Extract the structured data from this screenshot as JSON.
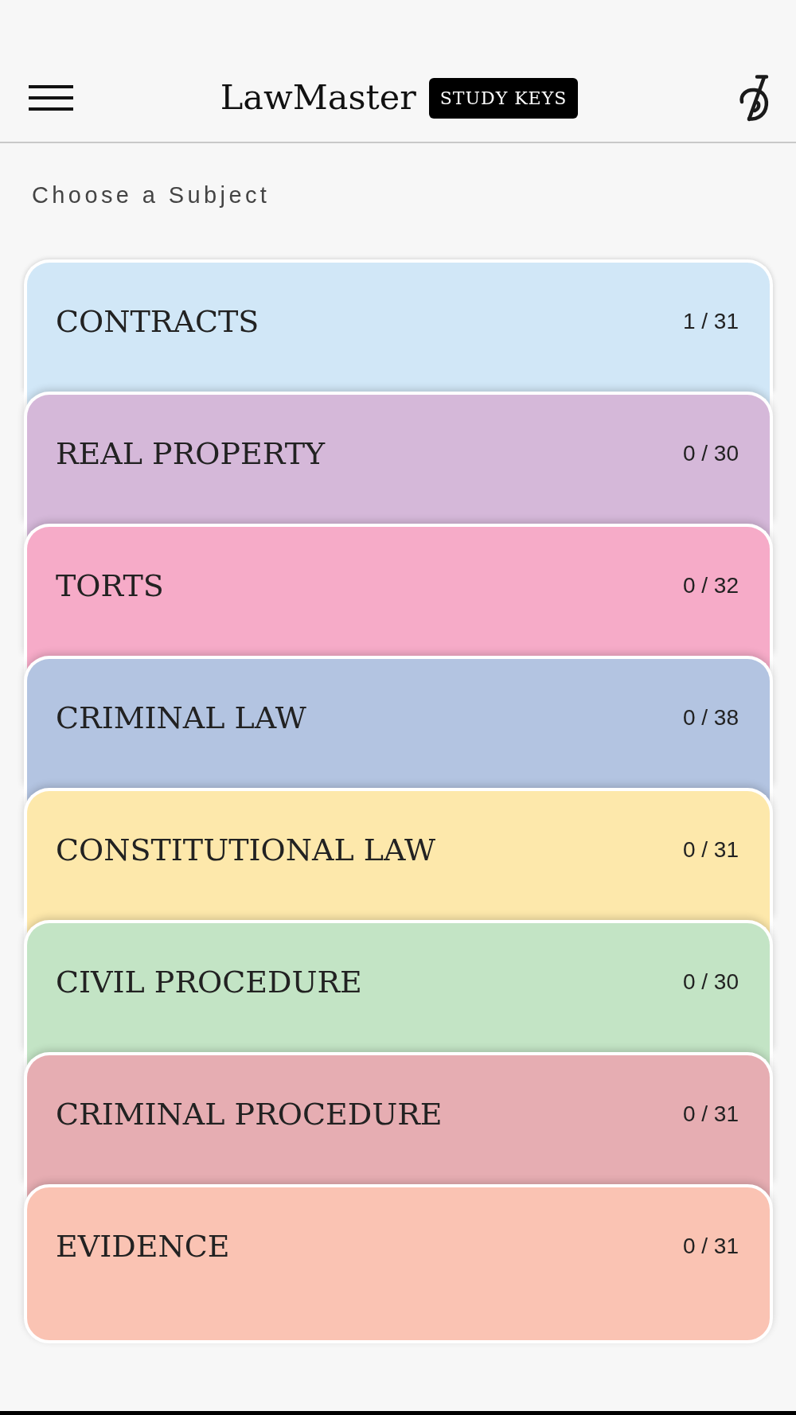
{
  "header": {
    "title": "LawMaster",
    "badge": "STUDY KEYS"
  },
  "heading": "Choose a Subject",
  "subjects": [
    {
      "name": "CONTRACTS",
      "progress": "1 / 31",
      "color": "#d1e7f7"
    },
    {
      "name": "REAL PROPERTY",
      "progress": "0 / 30",
      "color": "#d5b8d9"
    },
    {
      "name": "TORTS",
      "progress": "0 / 32",
      "color": "#f6abc8"
    },
    {
      "name": "CRIMINAL LAW",
      "progress": "0 / 38",
      "color": "#b3c4e1"
    },
    {
      "name": "CONSTITUTIONAL LAW",
      "progress": "0 / 31",
      "color": "#fde8ab"
    },
    {
      "name": "CIVIL PROCEDURE",
      "progress": "0 / 30",
      "color": "#c3e4c5"
    },
    {
      "name": "CRIMINAL PROCEDURE",
      "progress": "0 / 31",
      "color": "#e6adb2"
    },
    {
      "name": "EVIDENCE",
      "progress": "0 / 31",
      "color": "#fac3b3"
    }
  ]
}
